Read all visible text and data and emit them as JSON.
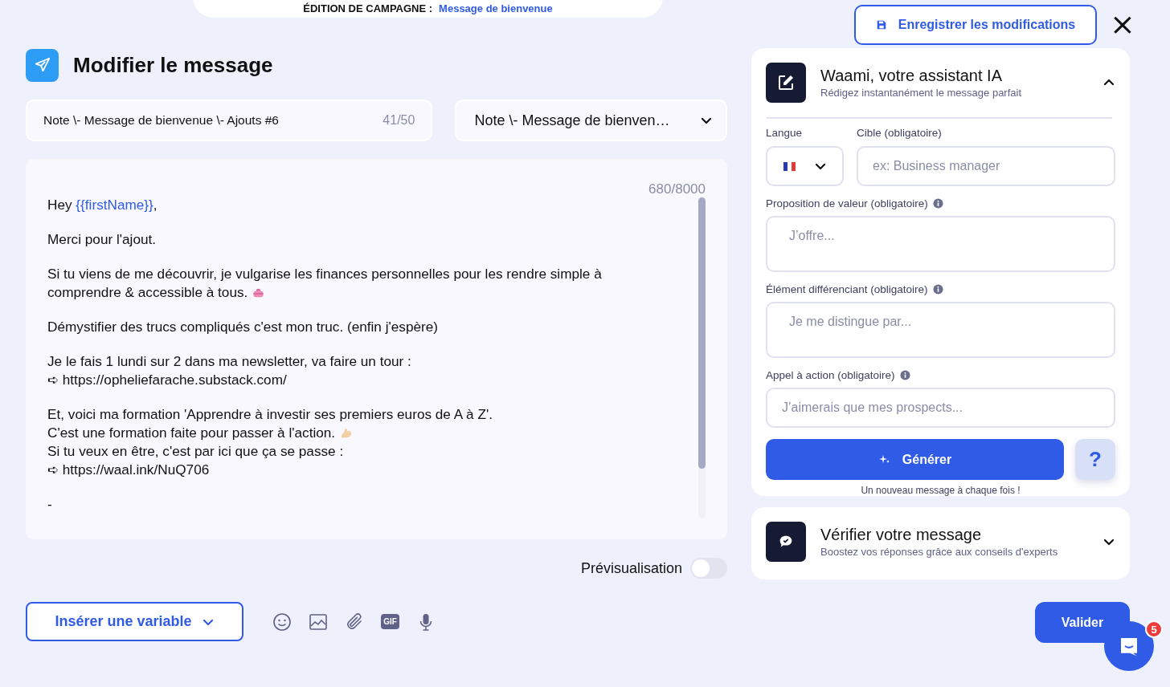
{
  "header": {
    "label": "ÉDITION DE CAMPAGNE :",
    "campaign": "Message de bienvenue"
  },
  "save_button": {
    "label": "Enregistrer les modifications"
  },
  "close": {
    "label": "×"
  },
  "title": "Modifier le message",
  "name_field": {
    "value": "Note \\- Message de bienvenue \\- Ajouts #6",
    "counter": "41/50"
  },
  "template_select": {
    "value": "Note \\- Message de bienven…"
  },
  "editor": {
    "counter": "680/8000",
    "paragraphs": [
      [
        [
          {
            "text": "Hey "
          },
          {
            "text": "{{firstName}}",
            "kind": "variable"
          },
          {
            "text": ","
          }
        ]
      ],
      [
        [
          {
            "text": "Merci pour l'ajout."
          }
        ]
      ],
      [
        [
          {
            "text": "Si tu viens de me découvrir, je vulgarise les finances personnelles pour les rendre simple à"
          }
        ],
        [
          {
            "text": "comprendre & accessible à tous. "
          },
          {
            "kind": "purse"
          }
        ]
      ],
      [
        [
          {
            "text": "Démystifier des trucs compliqués c'est mon truc. (enfin j'espère)"
          }
        ]
      ],
      [
        [
          {
            "text": "Je le fais 1 lundi sur 2 dans ma newsletter, va faire un tour :"
          }
        ],
        [
          {
            "text": "➪ https://opheliefarache.substack.com/"
          }
        ]
      ],
      [
        [
          {
            "text": "Et, voici ma formation 'Apprendre à investir ses premiers euros de A à Z'."
          }
        ],
        [
          {
            "text": "C'est une formation faite pour passer à l'action. "
          },
          {
            "kind": "arm"
          }
        ],
        [
          {
            "text": "Si tu veux en être, c'est par ici que ça se passe :"
          }
        ],
        [
          {
            "text": "➪ https://waal.ink/NuQ706"
          }
        ]
      ],
      [
        [
          {
            "text": "-"
          }
        ]
      ]
    ]
  },
  "preview": {
    "label": "Prévisualisation",
    "on": false
  },
  "insert_variable": {
    "label": "Insérer une variable"
  },
  "toolbar": [
    {
      "kind": "emoji"
    },
    {
      "kind": "image"
    },
    {
      "kind": "attach"
    },
    {
      "kind": "gif",
      "label": "GIF"
    },
    {
      "kind": "mic"
    }
  ],
  "assistant": {
    "title": "Waami, votre assistant IA",
    "subtitle": "Rédigez instantanément le message parfait",
    "expanded": true,
    "language_label": "Langue",
    "target_label": "Cible (obligatoire)",
    "target_placeholder": "ex: Business manager",
    "fields": [
      {
        "label": "Proposition de valeur (obligatoire)",
        "placeholder": "J’offre...",
        "kind": "area"
      },
      {
        "label": "Élément différenciant (obligatoire)",
        "placeholder": "Je me distingue par...",
        "kind": "area"
      },
      {
        "label": "Appel à action (obligatoire)",
        "placeholder": "J’aimerais que mes prospects...",
        "kind": "line"
      }
    ],
    "generate": "Générer",
    "help": "?",
    "note": "Un nouveau message à chaque fois !"
  },
  "checker": {
    "title": "Vérifier votre message",
    "subtitle": "Boostez vos réponses grâce aux conseils d'experts",
    "expanded": false
  },
  "validate": "Valider",
  "chat": {
    "badge": "5"
  }
}
